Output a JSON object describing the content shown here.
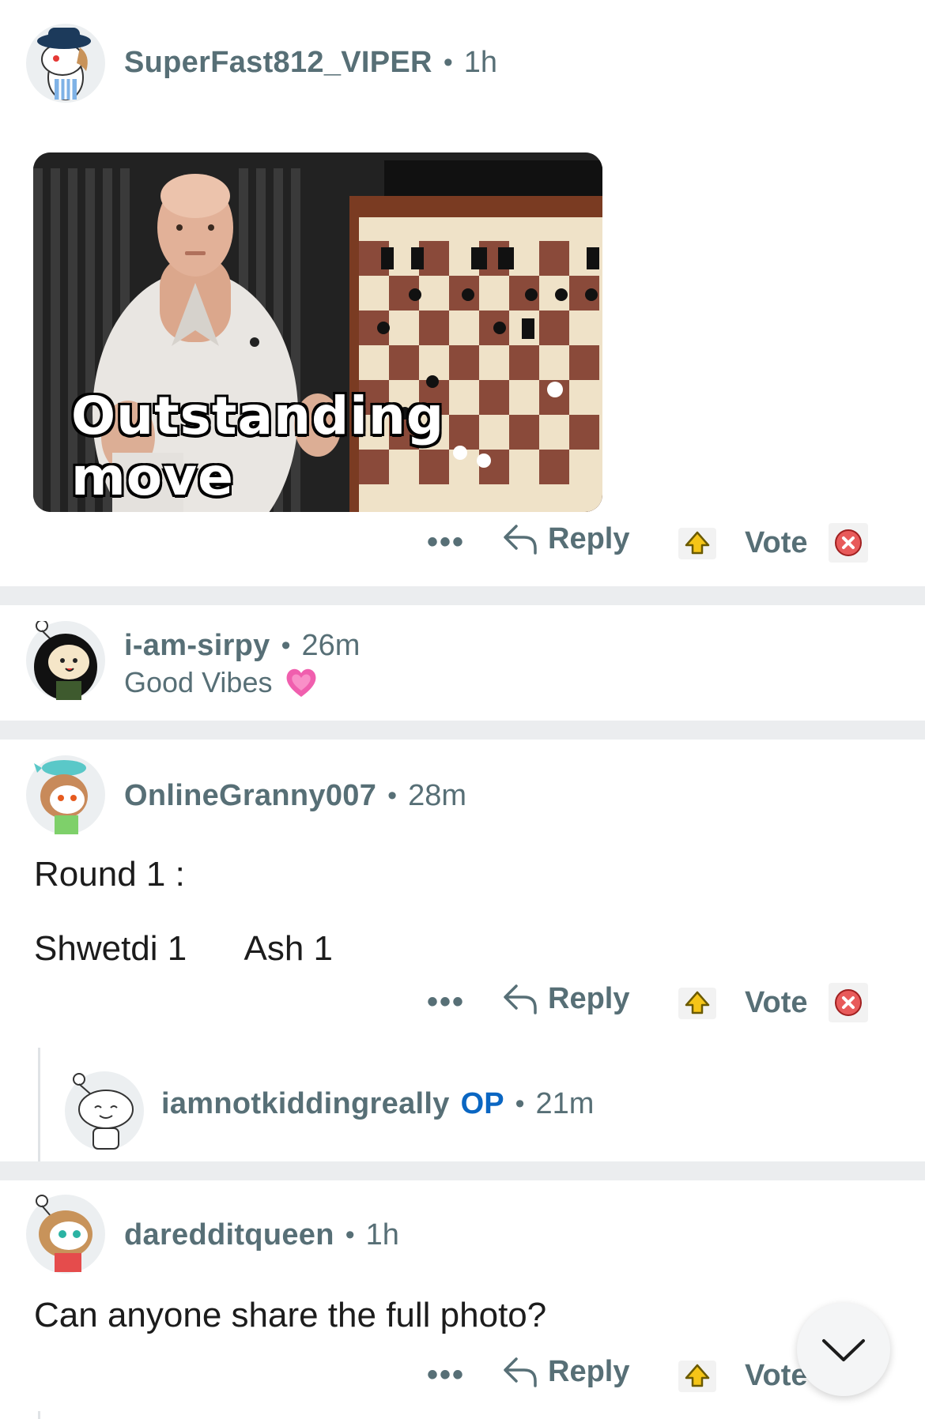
{
  "comments": [
    {
      "username": "SuperFast812_VIPER",
      "time": "1h",
      "gif_caption": "Outstanding move"
    },
    {
      "username": "i-am-sirpy",
      "time": "26m",
      "flair": "Good Vibes"
    },
    {
      "username": "OnlineGranny007",
      "time": "28m",
      "line1": "Round 1 :",
      "line2_left": "Shwetdi 1",
      "line2_right": "Ash 1"
    },
    {
      "username": "iamnotkiddingreally",
      "op_badge": "OP",
      "time": "21m"
    },
    {
      "username": "daredditqueen",
      "time": "1h",
      "text": "Can anyone share the full photo?"
    }
  ],
  "separator_dot": "•",
  "actions": {
    "more": "•••",
    "reply": "Reply",
    "vote": "Vote"
  },
  "colors": {
    "meta": "#576f76",
    "op": "#0a66c2",
    "separator": "#ebedef"
  },
  "icons": {
    "more": "more-options-icon",
    "reply": "reply-arrow-icon",
    "upvote": "upvote-award-icon",
    "downvote": "downvote-close-icon",
    "scroll": "chevron-down-icon",
    "flair": "pink-heart-icon"
  }
}
